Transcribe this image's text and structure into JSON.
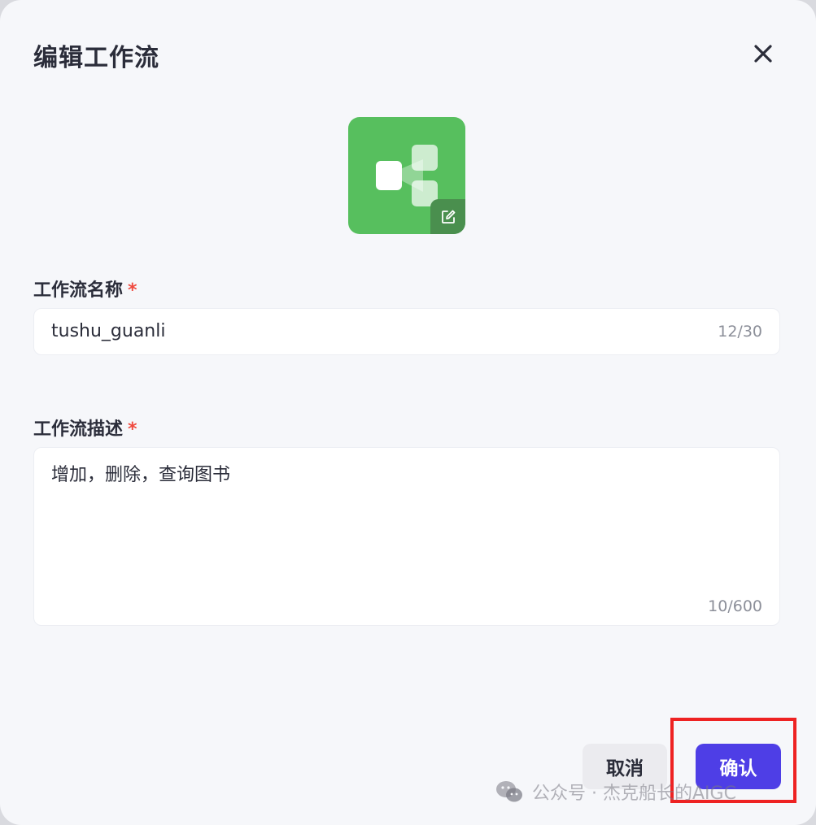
{
  "dialog": {
    "title": "编辑工作流",
    "close_icon": "close-icon"
  },
  "avatar": {
    "icon": "workflow-icon",
    "edit_icon": "edit-icon",
    "background": "#57bf5e"
  },
  "form": {
    "name": {
      "label": "工作流名称",
      "required_mark": "*",
      "value": "tushu_guanli",
      "counter": "12/30"
    },
    "description": {
      "label": "工作流描述",
      "required_mark": "*",
      "value": "增加，删除，查询图书",
      "counter": "10/600"
    }
  },
  "actions": {
    "cancel_label": "取消",
    "confirm_label": "确认",
    "confirm_color": "#4e3ee6"
  },
  "watermark": {
    "icon": "wechat-icon",
    "text": "公众号 · 杰克船长的AIGC"
  },
  "annotation": {
    "highlight_color": "#ee2222"
  }
}
